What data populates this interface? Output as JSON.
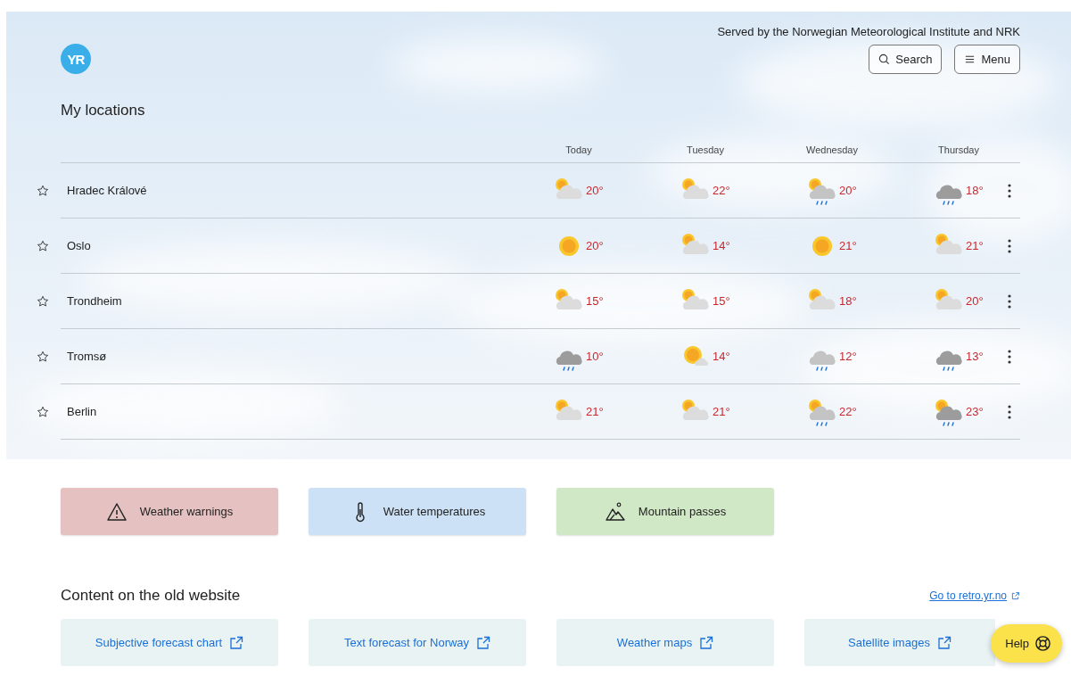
{
  "header": {
    "served_by": "Served by the Norwegian Meteorological Institute and NRK",
    "logo": "YR",
    "search_button": "Search",
    "menu_button": "Menu"
  },
  "locations": {
    "title": "My locations",
    "days": [
      "Today",
      "Tuesday",
      "Wednesday",
      "Thursday"
    ],
    "rows": [
      {
        "name": "Hradec Králové",
        "forecast": [
          {
            "kind": "partly_cloudy",
            "temp": "20°"
          },
          {
            "kind": "partly_cloudy",
            "temp": "22°"
          },
          {
            "kind": "partly_cloudy_rain",
            "temp": "20°"
          },
          {
            "kind": "heavy_rain",
            "temp": "18°"
          }
        ]
      },
      {
        "name": "Oslo",
        "forecast": [
          {
            "kind": "clear",
            "temp": "20°"
          },
          {
            "kind": "partly_cloudy",
            "temp": "14°"
          },
          {
            "kind": "clear",
            "temp": "21°"
          },
          {
            "kind": "partly_cloudy",
            "temp": "21°"
          }
        ]
      },
      {
        "name": "Trondheim",
        "forecast": [
          {
            "kind": "partly_cloudy",
            "temp": "15°"
          },
          {
            "kind": "partly_cloudy",
            "temp": "15°"
          },
          {
            "kind": "partly_cloudy",
            "temp": "18°"
          },
          {
            "kind": "partly_cloudy",
            "temp": "20°"
          }
        ]
      },
      {
        "name": "Tromsø",
        "forecast": [
          {
            "kind": "heavy_rain",
            "temp": "10°"
          },
          {
            "kind": "fair",
            "temp": "14°"
          },
          {
            "kind": "light_rain",
            "temp": "12°"
          },
          {
            "kind": "heavy_rain",
            "temp": "13°"
          }
        ]
      },
      {
        "name": "Berlin",
        "forecast": [
          {
            "kind": "partly_cloudy",
            "temp": "21°"
          },
          {
            "kind": "partly_cloudy",
            "temp": "21°"
          },
          {
            "kind": "partly_cloudy_rain",
            "temp": "22°"
          },
          {
            "kind": "partly_cloudy_heavy_rain",
            "temp": "23°"
          }
        ]
      }
    ]
  },
  "tiles": [
    {
      "label": "Weather warnings",
      "kind": "warning",
      "color": "#e5c1c1"
    },
    {
      "label": "Water temperatures",
      "kind": "thermometer",
      "color": "#cce1f6"
    },
    {
      "label": "Mountain passes",
      "kind": "mountain",
      "color": "#d1e8c6"
    }
  ],
  "old_website": {
    "title": "Content on the old website",
    "retro_link": "Go to retro.yr.no",
    "links": [
      "Subjective forecast chart",
      "Text forecast for Norway",
      "Weather maps",
      "Satellite images"
    ]
  },
  "help_button": "Help"
}
